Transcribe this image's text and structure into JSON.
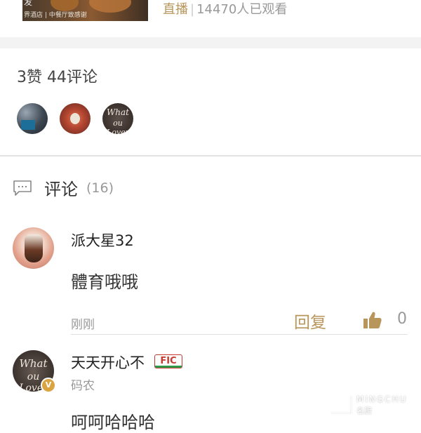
{
  "live_card": {
    "thumbnail": {
      "title_fragment": "发",
      "caption": "界酒店 | 中餐厅致感谢"
    },
    "live_label": "直播",
    "separator": "|",
    "view_count": "14470人已观看"
  },
  "stats": {
    "text": "3赞 44评论",
    "liker_avatars": [
      {
        "name": "avatar-1"
      },
      {
        "name": "avatar-2"
      },
      {
        "name": "avatar-3",
        "text_line1": "What",
        "text_line2": "ou Lover"
      }
    ]
  },
  "comments_section": {
    "title": "评论",
    "count": "(16)",
    "icon": "comment-bubble-icon"
  },
  "comments": [
    {
      "author": "派大星32",
      "text": "體育哦哦",
      "time": "刚刚",
      "reply_label": "回复",
      "like_count": "0"
    },
    {
      "author": "天天开心不",
      "badge": "FIC",
      "subtitle": "码农",
      "verified_badge": "V",
      "avatar_text_line1": "What",
      "avatar_text_line2": "ou Lover",
      "text": "呵呵哈哈哈"
    }
  ],
  "watermark": {
    "brand": "MINGCHU",
    "brand_cn": "名厨"
  },
  "colors": {
    "accent_gold": "#b8955a",
    "muted_gray": "#999999",
    "badge_red": "#c73a30",
    "badge_green": "#2e9a4c"
  }
}
